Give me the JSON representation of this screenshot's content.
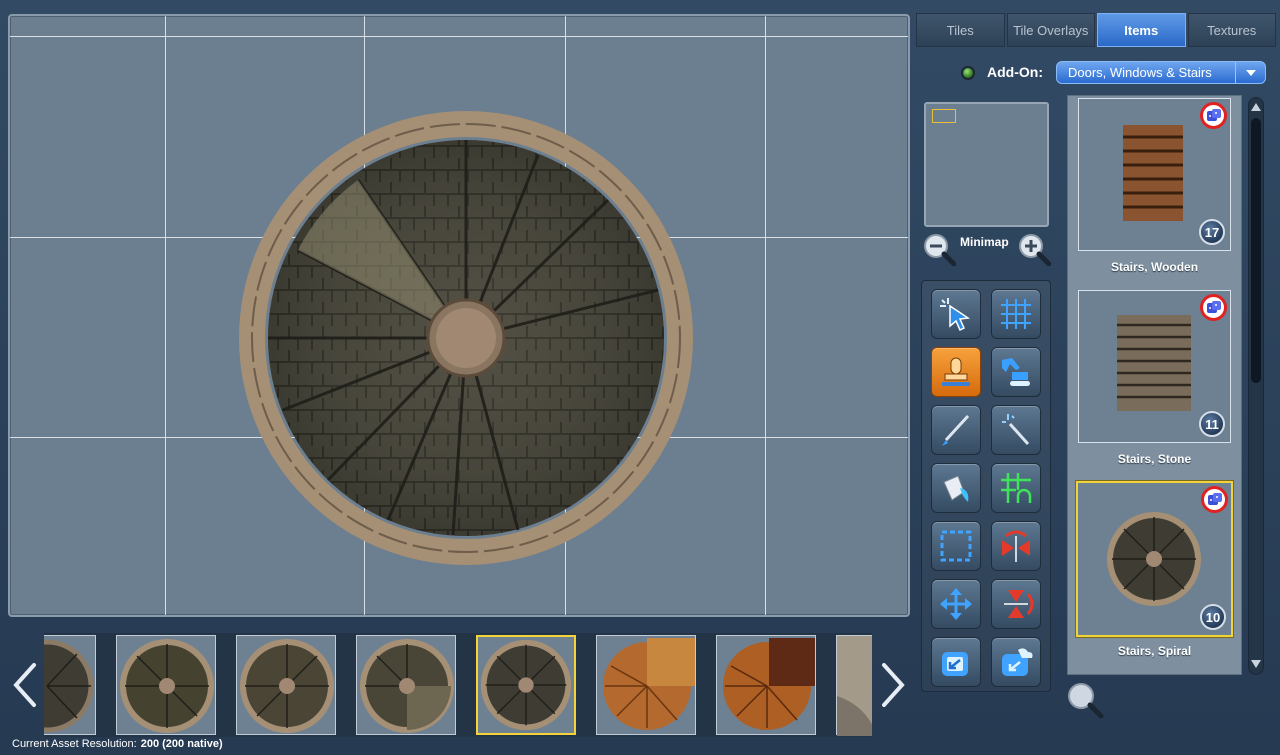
{
  "tabs": [
    {
      "label": "Tiles",
      "active": false
    },
    {
      "label": "Tile Overlays",
      "active": false
    },
    {
      "label": "Items",
      "active": true
    },
    {
      "label": "Textures",
      "active": false
    }
  ],
  "addon": {
    "label": "Add-On:",
    "selected": "Doors, Windows & Stairs"
  },
  "minimap": {
    "label": "Minimap"
  },
  "tools": [
    {
      "icon": "select-pointer-icon",
      "active": false
    },
    {
      "icon": "grid-icon",
      "active": false
    },
    {
      "icon": "stamp-icon",
      "active": true
    },
    {
      "icon": "excavator-icon",
      "active": false
    },
    {
      "icon": "brush-icon",
      "active": false
    },
    {
      "icon": "magic-wand-icon",
      "active": false
    },
    {
      "icon": "paint-bucket-icon",
      "active": false
    },
    {
      "icon": "grid-room-icon",
      "active": false
    },
    {
      "icon": "marquee-select-icon",
      "active": false
    },
    {
      "icon": "flip-horizontal-icon",
      "active": false
    },
    {
      "icon": "move-arrows-icon",
      "active": false
    },
    {
      "icon": "flip-vertical-icon",
      "active": false
    },
    {
      "icon": "export-icon",
      "active": false
    },
    {
      "icon": "cloud-export-icon",
      "active": false
    }
  ],
  "assets": [
    {
      "name": "Stairs, Wooden",
      "count": "17",
      "selected": false
    },
    {
      "name": "Stairs, Stone",
      "count": "11",
      "selected": false
    },
    {
      "name": "Stairs, Spiral",
      "count": "10",
      "selected": true
    }
  ],
  "status": {
    "label": "Current Asset Resolution:",
    "value": "200 (200 native)"
  },
  "colors": {
    "accent": "#2b69c8",
    "selection": "#f3d33a",
    "canvas": "#6b7f91",
    "active_tool": "#f7a23c"
  }
}
